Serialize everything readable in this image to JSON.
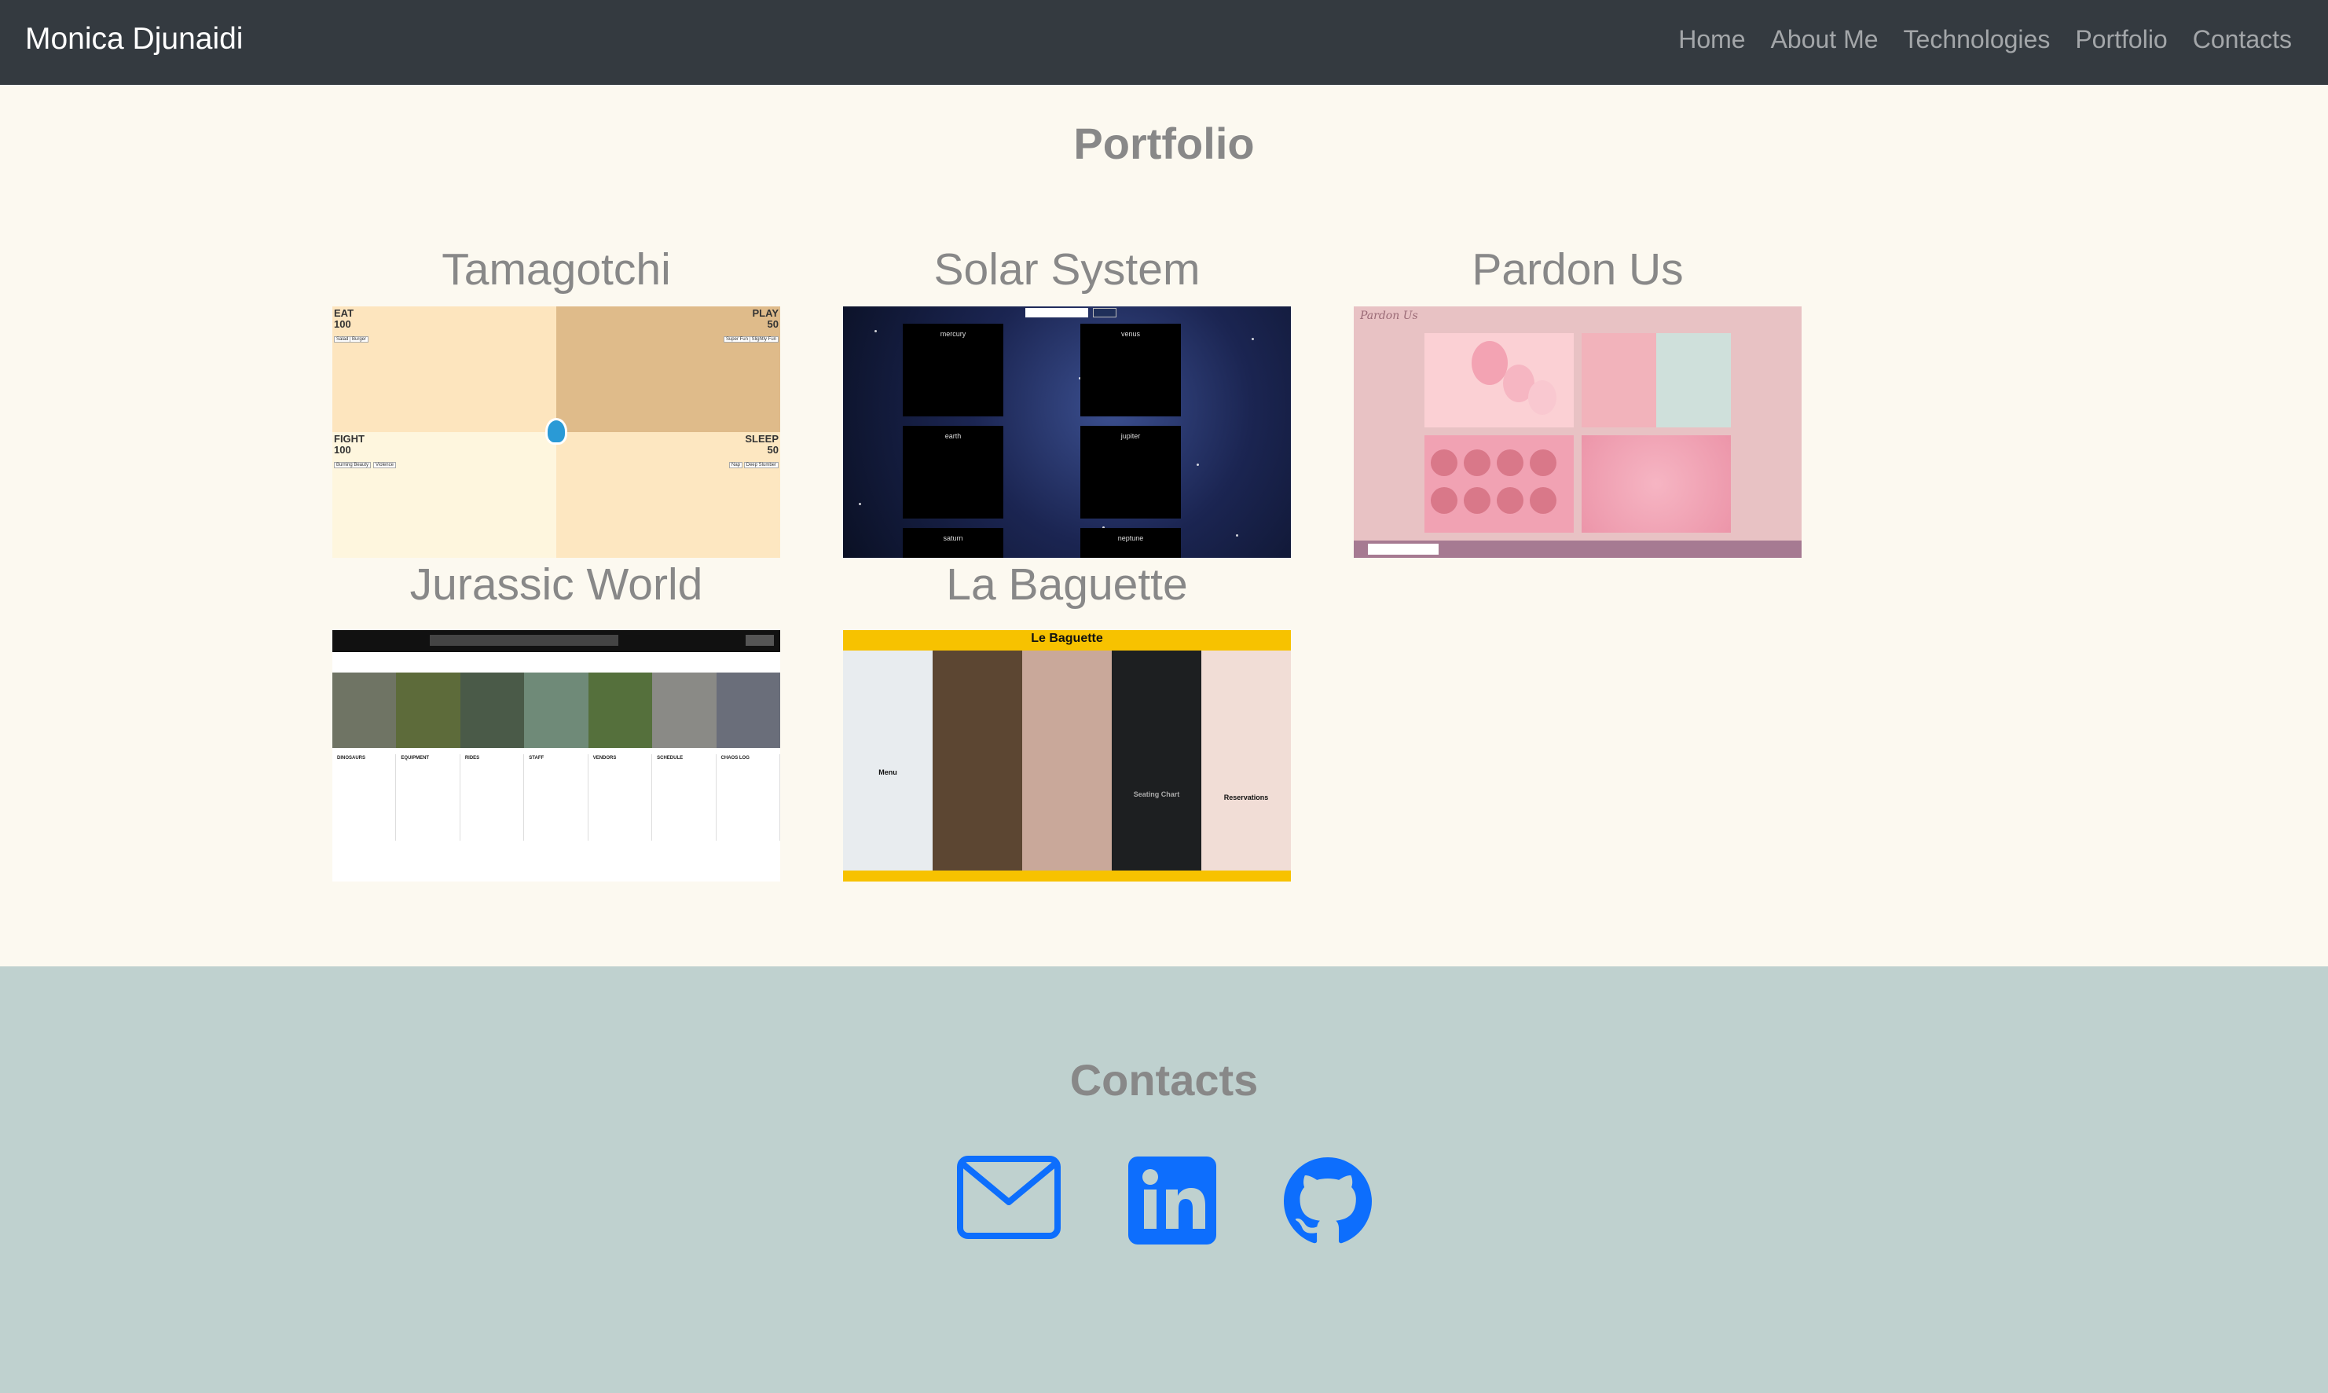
{
  "navbar": {
    "brand": "Monica Djunaidi",
    "links": [
      "Home",
      "About Me",
      "Technologies",
      "Portfolio",
      "Contacts"
    ]
  },
  "portfolio": {
    "title": "Portfolio",
    "projects": [
      {
        "title": "Tamagotchi",
        "screenshot": {
          "stats": [
            {
              "label": "EAT",
              "value": "100",
              "buttons": [
                "Salad",
                "Burger"
              ]
            },
            {
              "label": "PLAY",
              "value": "50",
              "buttons": [
                "Super Fun",
                "Slightly Fun"
              ]
            },
            {
              "label": "FIGHT",
              "value": "100",
              "buttons": [
                "Burning Beauty",
                "Violence"
              ]
            },
            {
              "label": "SLEEP",
              "value": "50",
              "buttons": [
                "Nap",
                "Deep Slumber"
              ]
            }
          ]
        }
      },
      {
        "title": "Solar System",
        "screenshot": {
          "planets": [
            "mercury",
            "venus",
            "earth",
            "jupiter",
            "saturn",
            "neptune"
          ]
        }
      },
      {
        "title": "Pardon Us",
        "screenshot": {
          "logo": "Pardon Us"
        }
      },
      {
        "title": "Jurassic World",
        "screenshot": {
          "columns": [
            "DINOSAURS",
            "EQUIPMENT",
            "RIDES",
            "STAFF",
            "VENDORS",
            "SCHEDULE",
            "CHAOS LOG"
          ]
        }
      },
      {
        "title": "La Baguette",
        "screenshot": {
          "brand": "Le Baguette",
          "panels": [
            "Menu",
            "Seating Chart",
            "Reservations"
          ]
        }
      }
    ]
  },
  "contacts": {
    "title": "Contacts",
    "icons": [
      "email-icon",
      "linkedin-icon",
      "github-icon"
    ],
    "icon_color": "#0d6efd"
  },
  "colors": {
    "navbar": "#343a40",
    "portfolio_bg": "#fcf9f0",
    "contacts_bg": "#bfd1cf",
    "heading": "#888888"
  }
}
